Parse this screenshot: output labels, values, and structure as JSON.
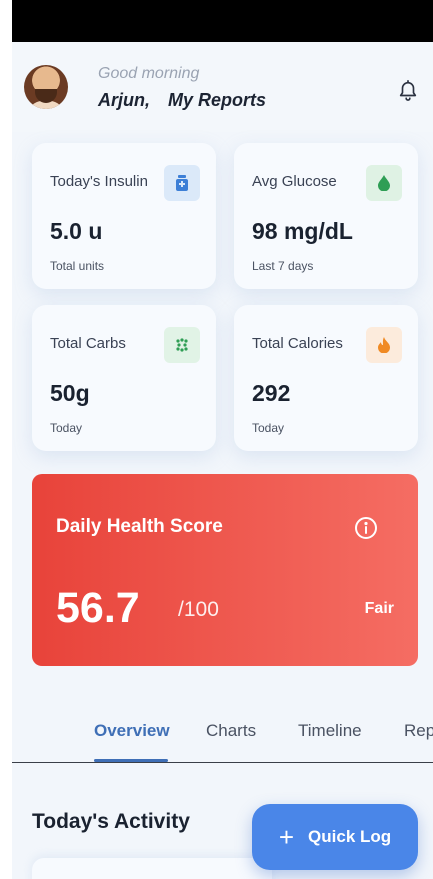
{
  "header": {
    "greeting": "Good morning",
    "user_name": "Arjun,",
    "page_title": "My Reports",
    "avatar": "user-avatar",
    "bell_icon": "bell-icon"
  },
  "stats": [
    {
      "label": "Today's Insulin",
      "value": "5.0 u",
      "sub": "Total units",
      "icon": "insulin-vial-icon",
      "icon_bg": "#dbe9f9",
      "icon_color": "#3d7fd6"
    },
    {
      "label": "Avg Glucose",
      "value": "98 mg/dL",
      "sub": "Last 7 days",
      "icon": "blood-drop-icon",
      "icon_bg": "#dff2e4",
      "icon_color": "#2f9e55"
    },
    {
      "label": "Total Carbs",
      "value": "50g",
      "sub": "Today",
      "icon": "grain-icon",
      "icon_bg": "#e1f3e6",
      "icon_color": "#2f9e55"
    },
    {
      "label": "Total Calories",
      "value": "292",
      "sub": "Today",
      "icon": "flame-icon",
      "icon_bg": "#fcebdc",
      "icon_color": "#f08a24"
    }
  ],
  "health_score": {
    "title": "Daily Health Score",
    "value": "56.7",
    "max": "/100",
    "rating": "Fair",
    "info_icon": "info-icon",
    "gradient": [
      "#e8433a",
      "#f56d63"
    ]
  },
  "tabs": [
    {
      "label": "Overview",
      "active": true
    },
    {
      "label": "Charts",
      "active": false
    },
    {
      "label": "Timeline",
      "active": false
    },
    {
      "label": "Rep",
      "active": false
    }
  ],
  "section_title": "Today's Activity",
  "fab": {
    "label": "Quick Log",
    "icon": "plus-icon",
    "color": "#4a86e8"
  },
  "accent": "#3f6fb6"
}
